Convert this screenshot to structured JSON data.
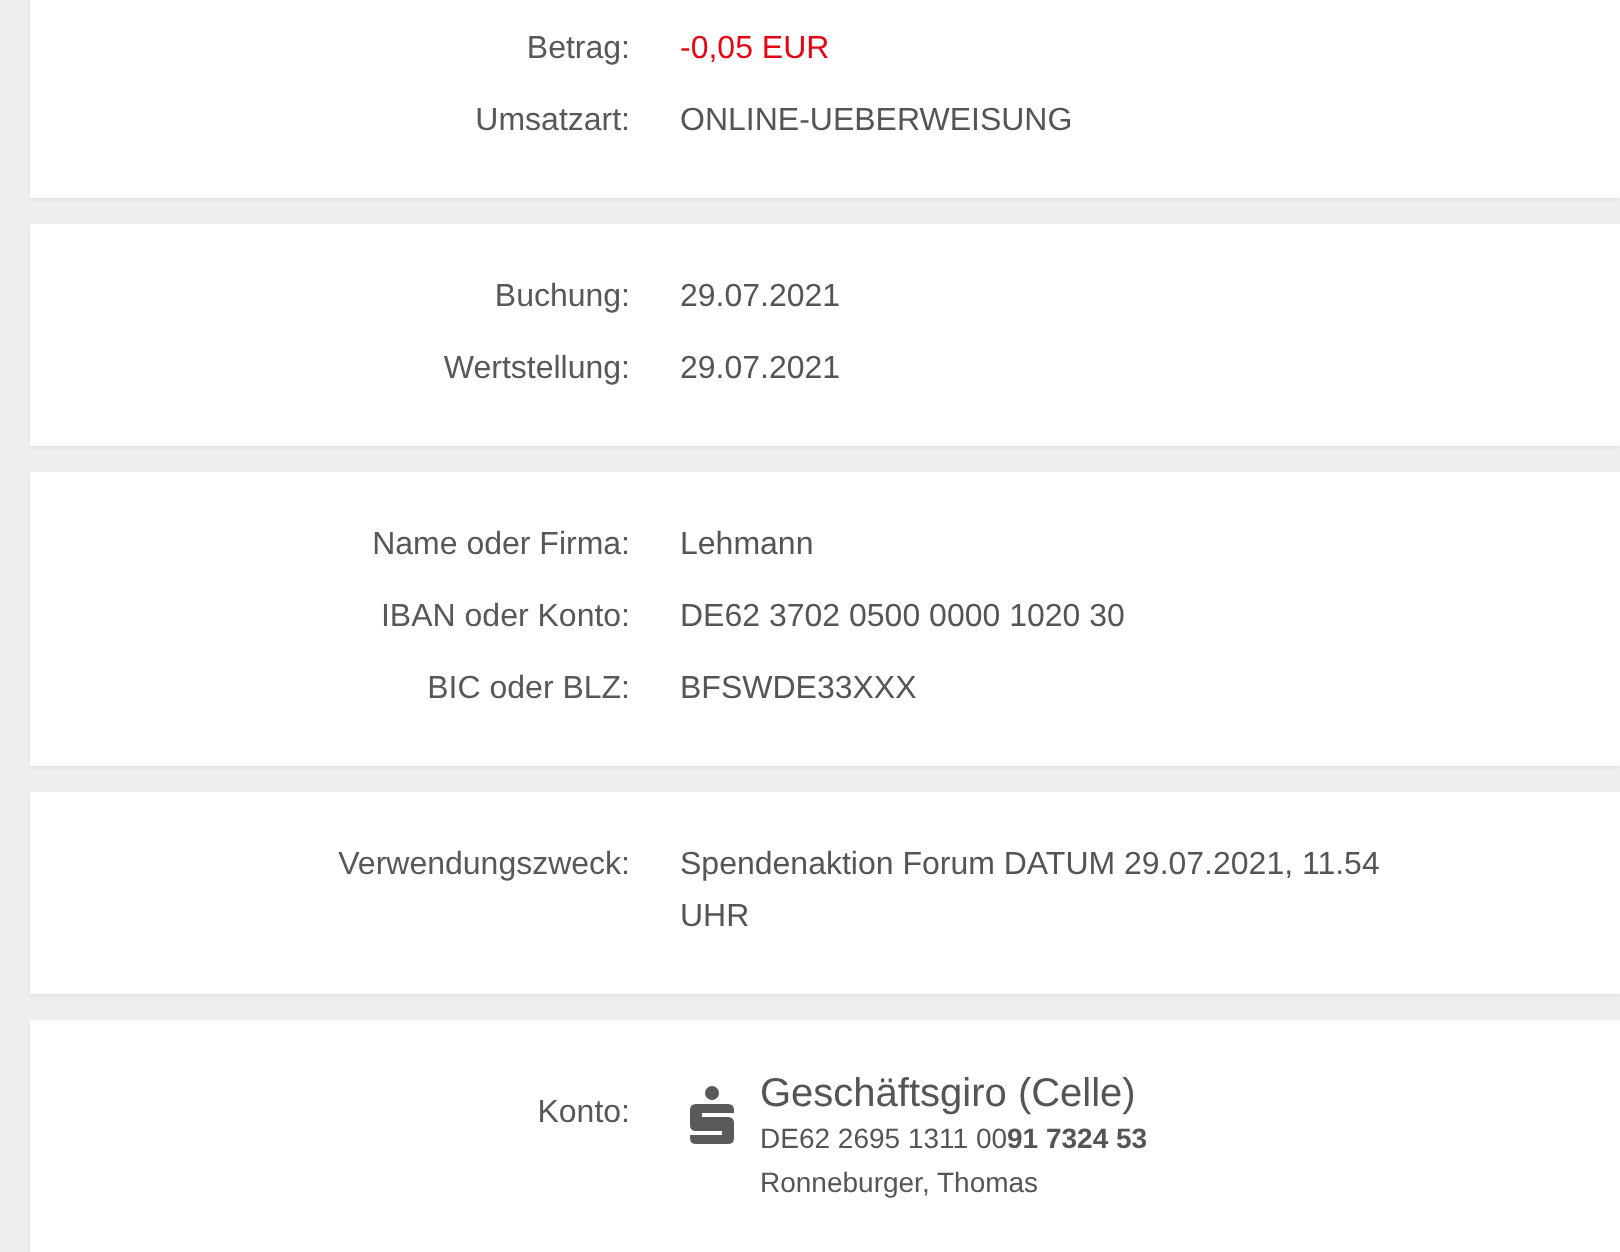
{
  "sections": [
    {
      "fields": [
        {
          "kind": "amount",
          "label": "Betrag:",
          "value": "-0,05 EUR"
        },
        {
          "kind": "text",
          "label": "Umsatzart:",
          "value": "ONLINE-UEBERWEISUNG"
        }
      ]
    },
    {
      "fields": [
        {
          "kind": "text",
          "label": "Buchung:",
          "value": "29.07.2021"
        },
        {
          "kind": "text",
          "label": "Wertstellung:",
          "value": "29.07.2021"
        }
      ]
    },
    {
      "fields": [
        {
          "kind": "text",
          "label": "Name oder Firma:",
          "value": "Lehmann"
        },
        {
          "kind": "text",
          "label": "IBAN oder Konto:",
          "value": "DE62 3702 0500 0000 1020 30"
        },
        {
          "kind": "text",
          "label": "BIC oder BLZ:",
          "value": "BFSWDE33XXX"
        }
      ]
    },
    {
      "fields": [
        {
          "kind": "text",
          "label": "Verwendungszweck:",
          "value": "Spendenaktion Forum DATUM 29.07.2021, 11.54 UHR"
        }
      ]
    },
    {
      "fields": [
        {
          "kind": "account",
          "label": "Konto:",
          "title": "Geschäftsgiro (Celle)",
          "iban": "DE62 2695 1311 00**91 7324 53**",
          "holder": "Ronneburger, Thomas"
        }
      ]
    }
  ]
}
